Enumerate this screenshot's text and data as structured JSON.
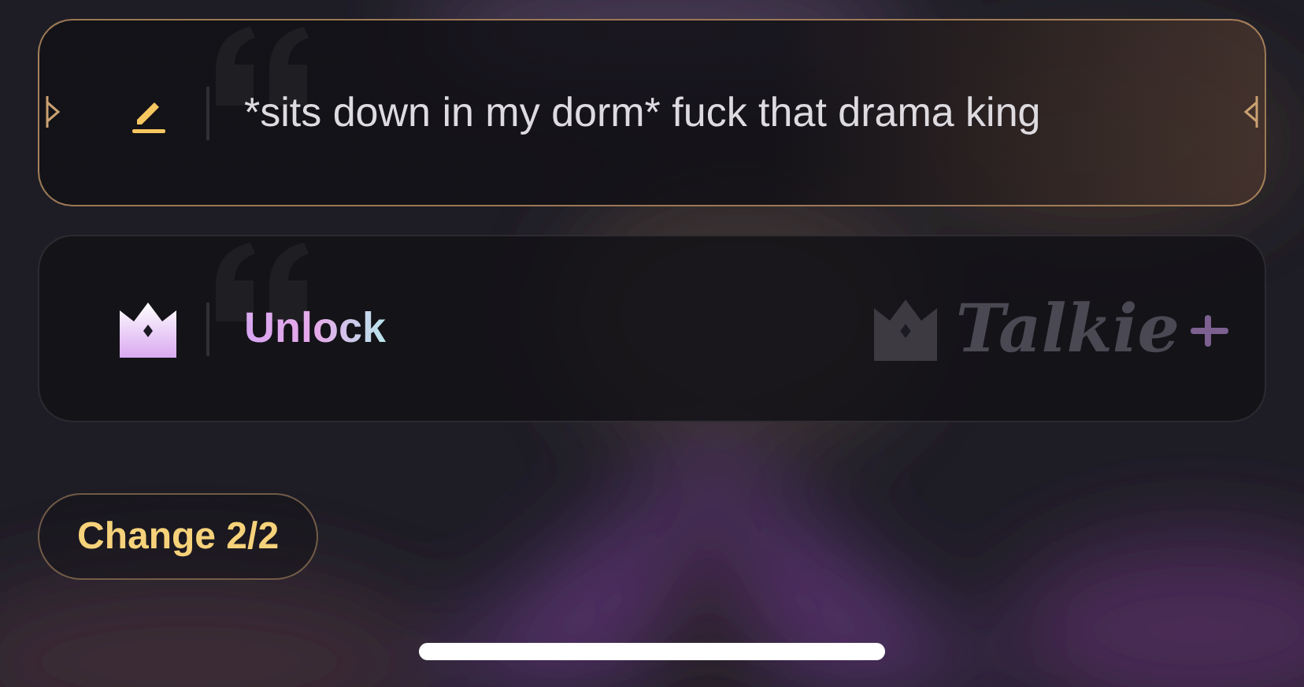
{
  "options": [
    {
      "kind": "reply",
      "text": "*sits down in my dorm* fuck that drama king",
      "selected": true
    },
    {
      "kind": "locked",
      "text": "Unlock",
      "brand": "Talkie",
      "selected": false
    }
  ],
  "change_button": {
    "label": "Change 2/2"
  }
}
